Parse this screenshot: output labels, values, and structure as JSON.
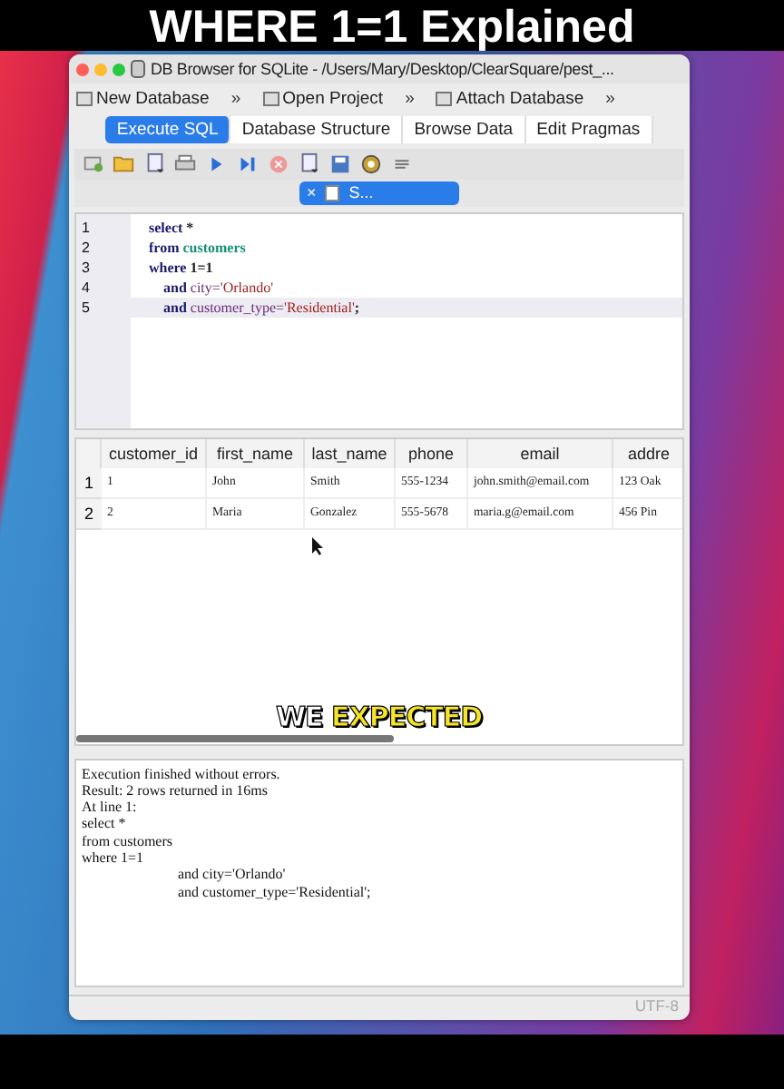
{
  "caption_title": "WHERE 1=1 Explained",
  "window": {
    "title": "DB Browser for SQLite - /Users/Mary/Desktop/ClearSquare/pest_..."
  },
  "toolbar": [
    {
      "label": "New Database",
      "more": "»"
    },
    {
      "label": "Open Project",
      "more": "»"
    },
    {
      "label": "Attach Database",
      "more": "»"
    }
  ],
  "tabs": [
    {
      "label": "Execute SQL",
      "selected": true
    },
    {
      "label": "Database Structure",
      "selected": false
    },
    {
      "label": "Browse Data",
      "selected": false
    },
    {
      "label": "Edit Pragmas",
      "selected": false
    }
  ],
  "sql_tab": {
    "close": "×",
    "label": "S..."
  },
  "editor": {
    "lines": [
      {
        "number": "1",
        "current": false,
        "indent": false,
        "tokens": [
          {
            "kind": "keyword",
            "text": "select"
          },
          {
            "kind": "plain",
            "text": " *"
          }
        ]
      },
      {
        "number": "2",
        "current": false,
        "indent": false,
        "tokens": [
          {
            "kind": "keyword",
            "text": "from"
          },
          {
            "kind": "table",
            "text": " customers"
          }
        ]
      },
      {
        "number": "3",
        "current": false,
        "indent": false,
        "tokens": [
          {
            "kind": "keyword",
            "text": "where"
          },
          {
            "kind": "plain",
            "text": " 1=1"
          }
        ]
      },
      {
        "number": "4",
        "current": false,
        "indent": true,
        "tokens": [
          {
            "kind": "keyword",
            "text": "and"
          },
          {
            "kind": "column",
            "text": " city="
          },
          {
            "kind": "string",
            "text": "'Orlando'"
          }
        ]
      },
      {
        "number": "5",
        "current": true,
        "indent": true,
        "tokens": [
          {
            "kind": "keyword",
            "text": "and"
          },
          {
            "kind": "column",
            "text": " customer_type="
          },
          {
            "kind": "string",
            "text": "'Residential'"
          },
          {
            "kind": "plain",
            "text": ";"
          }
        ]
      }
    ]
  },
  "results": {
    "columns": [
      "customer_id",
      "first_name",
      "last_name",
      "phone",
      "email",
      "addre"
    ],
    "rows": [
      {
        "number": "1",
        "cells": [
          "1",
          "John",
          "Smith",
          "555-1234",
          "john.smith@email.com",
          "123 Oak"
        ]
      },
      {
        "number": "2",
        "cells": [
          "2",
          "Maria",
          "Gonzalez",
          "555-5678",
          "maria.g@email.com",
          "456 Pin"
        ]
      }
    ]
  },
  "caption_overlay": [
    {
      "kind": "plain",
      "text": "WE"
    },
    {
      "kind": "highlight",
      "text": "EXPECTED"
    }
  ],
  "messages": [
    {
      "text": "Execution finished without errors.",
      "indent": false
    },
    {
      "text": "Result: 2 rows returned in 16ms",
      "indent": false
    },
    {
      "text": "At line 1:",
      "indent": false
    },
    {
      "text": "select *",
      "indent": false
    },
    {
      "text": "from customers",
      "indent": false
    },
    {
      "text": "where 1=1",
      "indent": false
    },
    {
      "text": "and city='Orlando'",
      "indent": true
    },
    {
      "text": "and customer_type='Residential';",
      "indent": true
    }
  ],
  "status_bar": {
    "encoding": "UTF-8"
  }
}
